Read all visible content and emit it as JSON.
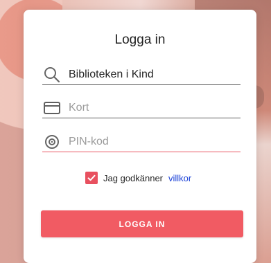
{
  "login": {
    "title": "Logga in",
    "library_value": "Biblioteken i Kind",
    "card_placeholder": "Kort",
    "pin_placeholder": "PIN-kod",
    "terms_text": "Jag godkänner",
    "terms_link": "villkor",
    "button_label": "LOGGA IN"
  },
  "icons": {
    "library": "search-icon",
    "card": "credit-card-icon",
    "pin": "pin-target-icon",
    "check": "checkmark-icon"
  },
  "colors": {
    "accent": "#F15B63",
    "link": "#1D43D8",
    "text": "#262626"
  }
}
